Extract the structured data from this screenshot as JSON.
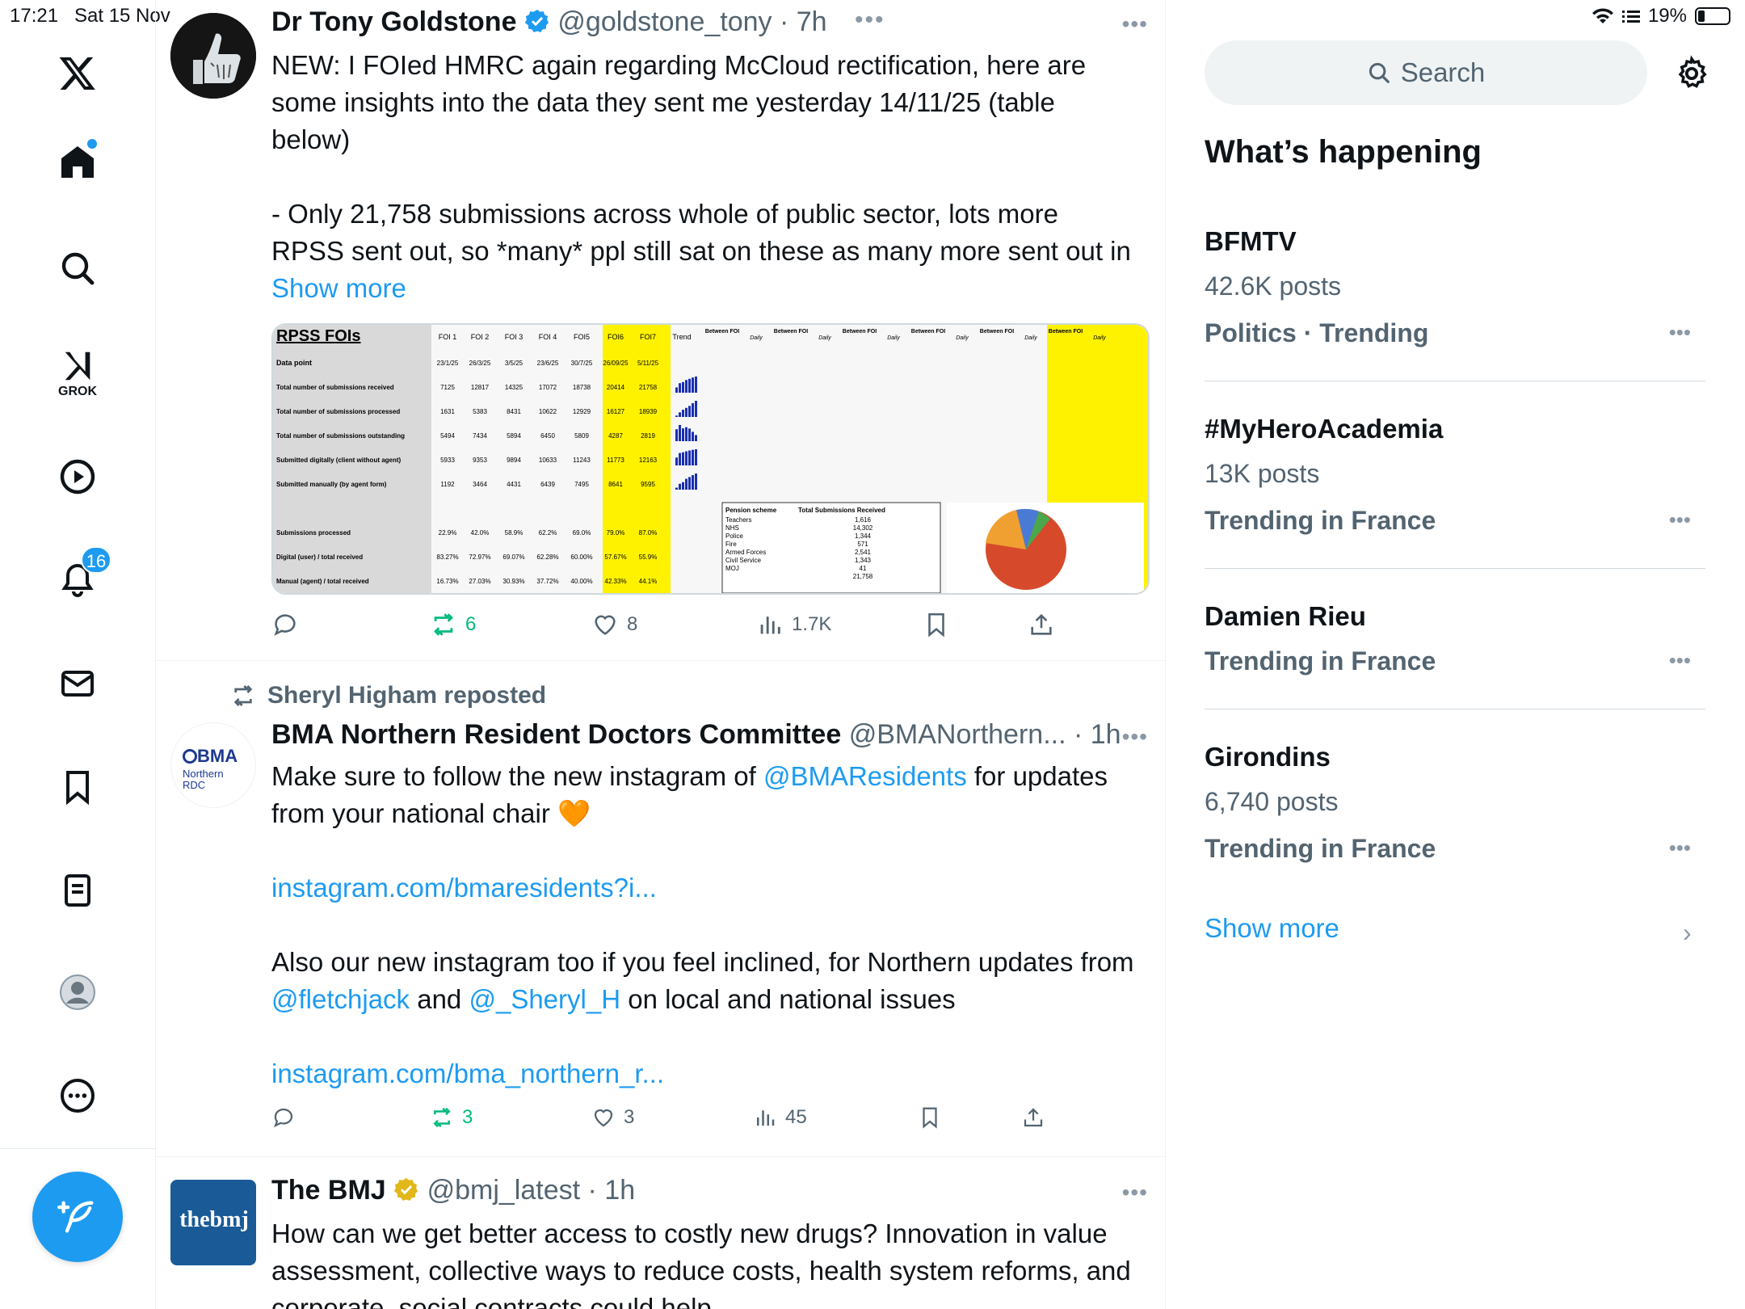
{
  "status": {
    "time": "17:21",
    "date": "Sat 15 Nov",
    "battery": "19%"
  },
  "nav": {
    "grok_label": "GROK",
    "notifications_count": "16"
  },
  "tweets": [
    {
      "name": "Dr Tony Goldstone",
      "handle": "@goldstone_tony",
      "time": "· 7h",
      "body_1": "NEW: I FOIed HMRC again regarding McCloud rectification, here are some insights into the data they sent me yesterday 14/11/25 (table below)",
      "body_2": "- Only 21,758 submissions across whole of public sector, lots more RPSS sent out, so *many* ppl still sat on these as many more sent out in",
      "show_more": "Show more",
      "replies": "",
      "reposts": "6",
      "likes": "8",
      "views": "1.7K"
    },
    {
      "reposted_by": "Sheryl Higham reposted",
      "name": "BMA Northern Resident Doctors Committee",
      "handle": "@BMANorthern...",
      "time": "· 1h",
      "avatar_text_1": "BMA",
      "avatar_text_2": "Northern",
      "avatar_text_3": "RDC",
      "body_1a": "Make sure to follow the new instagram of ",
      "body_1_link": "@BMAResidents",
      "body_1b": " for updates from your national chair 🧡",
      "link_1": "instagram.com/bmaresidents?i...",
      "body_2a": "Also our new instagram too if you feel inclined, for Northern updates from ",
      "body_2_link1": "@fletchjack",
      "body_2b": " and ",
      "body_2_link2": "@_Sheryl_H",
      "body_2c": " on local and national issues",
      "link_2": "instagram.com/bma_northern_r...",
      "reposts": "3",
      "likes": "3",
      "views": "45"
    },
    {
      "name": "The BMJ",
      "handle": "@bmj_latest",
      "time": "· 1h",
      "avatar_text": "thebmj",
      "body": "How can we get better access to costly new drugs? Innovation in value assessment, collective ways to reduce costs, health system reforms, and corporate, social contracts could help"
    }
  ],
  "table_image": {
    "title": "RPSS FOIs",
    "cols": [
      "FOI 1",
      "FOI 2",
      "FOI 3",
      "FOI 4",
      "FOI5",
      "FOI6",
      "FOI7",
      "Trend"
    ],
    "col_dates": [
      "23/1/25",
      "26/3/25",
      "3/5/25",
      "23/6/25",
      "30/7/25",
      "26/09/25",
      "5/11/25"
    ],
    "rows": [
      {
        "label": "Total number of submissions received",
        "values": [
          "7125",
          "12817",
          "14325",
          "17072",
          "18738",
          "20414",
          "21758"
        ]
      },
      {
        "label": "Total number of submissions processed",
        "values": [
          "1631",
          "5383",
          "8431",
          "10622",
          "12929",
          "16127",
          "18939"
        ]
      },
      {
        "label": "Total number of submissions outstanding",
        "values": [
          "5494",
          "7434",
          "5894",
          "6450",
          "5809",
          "4287",
          "2819"
        ]
      },
      {
        "label": "Submitted digitally (client without agent)",
        "values": [
          "5933",
          "9353",
          "9894",
          "10633",
          "11243",
          "11773",
          "12163"
        ]
      },
      {
        "label": "Submitted manually (by agent form)",
        "values": [
          "1192",
          "3464",
          "4431",
          "6439",
          "7495",
          "8641",
          "9595"
        ]
      }
    ],
    "pct_rows": [
      {
        "label": "Submissions processed",
        "values": [
          "22.9%",
          "42.0%",
          "58.9%",
          "62.2%",
          "69.0%",
          "79.0%",
          "87.0%"
        ]
      },
      {
        "label": "Digital (user) / total received",
        "values": [
          "83.27%",
          "72.97%",
          "69.07%",
          "62.28%",
          "60.00%",
          "57.67%",
          "55.9%"
        ]
      },
      {
        "label": "Manual (agent) / total received",
        "values": [
          "16.73%",
          "27.03%",
          "30.93%",
          "37.72%",
          "40.00%",
          "42.33%",
          "44.1%"
        ]
      }
    ],
    "data_point_label": "Data point",
    "between_label": "Between FOI",
    "daily_label": "Daily",
    "pension_header": "Pension scheme",
    "total_header": "Total Submissions Received",
    "schemes": [
      "Teachers",
      "NHS",
      "Police",
      "Fire",
      "Armed Forces",
      "Civil Service",
      "MOJ"
    ],
    "scheme_totals": [
      "1,616",
      "14,302",
      "1,344",
      "571",
      "2,541",
      "1,343",
      "41",
      "21,758"
    ]
  },
  "search": {
    "placeholder": "Search"
  },
  "whats_happening": "What’s happening",
  "trends": [
    {
      "name": "BFMTV",
      "posts": "42.6K posts",
      "context": "Politics · Trending"
    },
    {
      "name": "#MyHeroAcademia",
      "posts": "13K posts",
      "context": "Trending in France"
    },
    {
      "name": "Damien Rieu",
      "posts": "",
      "context": "Trending in France"
    },
    {
      "name": "Girondins",
      "posts": "6,740 posts",
      "context": "Trending in France"
    }
  ],
  "show_more": "Show more",
  "colors": {
    "accent": "#1d9bf0",
    "green": "#00ba7c",
    "muted": "#536471"
  }
}
